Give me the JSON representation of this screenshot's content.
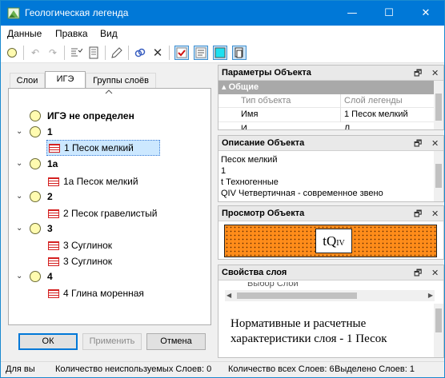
{
  "window": {
    "title": "Геологическая легенда",
    "minimize": "—",
    "maximize": "☐",
    "close": "✕"
  },
  "menu": [
    "Данные",
    "Правка",
    "Вид"
  ],
  "tabs": [
    "Слои",
    "ИГЭ",
    "Группы слоёв"
  ],
  "tree": [
    {
      "label": "ИГЭ не определен",
      "type": "ige",
      "bold": true,
      "expanded": false
    },
    {
      "label": "1",
      "type": "ige",
      "bold": true,
      "expanded": true
    },
    {
      "label": "1 Песок мелкий",
      "type": "layer",
      "selected": true
    },
    {
      "label": "1а",
      "type": "ige",
      "bold": true,
      "expanded": true
    },
    {
      "label": "1а Песок мелкий",
      "type": "layer"
    },
    {
      "label": "2",
      "type": "ige",
      "bold": true,
      "expanded": true
    },
    {
      "label": "2 Песок гравелистый",
      "type": "layer"
    },
    {
      "label": "3",
      "type": "ige",
      "bold": true,
      "expanded": true
    },
    {
      "label": "3 Суглинок",
      "type": "layer"
    },
    {
      "label": "3 Суглинок",
      "type": "layer"
    },
    {
      "label": "4",
      "type": "ige",
      "bold": true,
      "expanded": true
    },
    {
      "label": "4 Глина моренная",
      "type": "layer"
    }
  ],
  "buttons": {
    "ok": "ОК",
    "apply": "Применить",
    "cancel": "Отмена"
  },
  "params": {
    "title": "Параметры Объекта",
    "group": "Общие",
    "header": [
      "Тип объекта",
      "Слой легенды"
    ],
    "row": [
      "Имя",
      "1 Песок мелкий"
    ],
    "partial": [
      "И",
      "Л"
    ]
  },
  "desc": {
    "title": "Описание Объекта",
    "lines": [
      "Песок мелкий",
      "1",
      "t Техногенные",
      "QIV Четвертичная - современное звено"
    ]
  },
  "preview": {
    "title": "Просмотр Объекта",
    "symbol_main": "tQ",
    "symbol_sub": "IV"
  },
  "props": {
    "title": "Свойства слоя",
    "top_partial": "Выбор Слой",
    "text1": "Нормативные и расчетные",
    "text2": "характеристики слоя - 1 Песок"
  },
  "status": [
    "Для вы",
    "Количество неиспользуемых Слоев: 0",
    "Количество всех Слоев: 6",
    "Выделено Слоев: 1"
  ],
  "panel_icons": {
    "float": "🗗",
    "close": "✕"
  },
  "colors": {
    "titlebar": "#0078d7",
    "selection": "#cce8ff",
    "preview_fill": "#ff8c1a",
    "brick": "#d42020"
  }
}
